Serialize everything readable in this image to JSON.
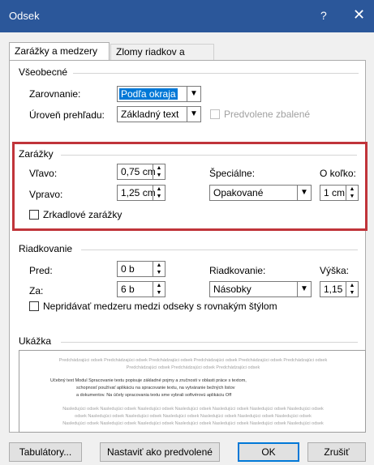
{
  "window": {
    "title": "Odsek",
    "help": "?",
    "close": "✕"
  },
  "tabs": {
    "indents_spacing": "Zarážky a medzery",
    "line_page_breaks": "Zlomy riadkov a strán"
  },
  "general": {
    "title": "Všeobecné",
    "alignment_label": "Zarovnanie:",
    "alignment_value": "Podľa okraja",
    "outline_label": "Úroveň prehľadu:",
    "outline_value": "Základný text",
    "collapsed_label": "Predvolene zbalené"
  },
  "indentation": {
    "title": "Zarážky",
    "left_label": "Vľavo:",
    "left_value": "0,75 cm",
    "right_label": "Vpravo:",
    "right_value": "1,25 cm",
    "special_label": "Špeciálne:",
    "special_value": "Opakované",
    "by_label": "O koľko:",
    "by_value": "1 cm",
    "mirror_label": "Zrkadlové zarážky"
  },
  "spacing": {
    "title": "Riadkovanie",
    "before_label": "Pred:",
    "before_value": "0 b",
    "after_label": "Za:",
    "after_value": "6 b",
    "line_label": "Riadkovanie:",
    "line_value": "Násobky",
    "at_label": "Výška:",
    "at_value": "1,15",
    "dont_add_label": "Nepridávať medzeru medzi odseky s rovnakým štýlom"
  },
  "preview": {
    "title": "Ukážka",
    "prev_line1": "Predchádzajúci odsek Predchádzajúci odsek Predchádzajúci odsek Predchádzajúci odsek Predchádzajúci odsek Predchádzajúci odsek",
    "prev_line2": "Predchádzajúci odsek Predchádzajúci odsek Predchádzajúci odsek",
    "sample_line1": "Učebný text Modul Spracovanie textu popisuje základné pojmy a zručnosti v oblasti práce s textom,",
    "sample_line2": "schopnosť používať aplikáciu na spracovanie textu, na vytváranie bežných listov",
    "sample_line3": "a dokumentov. Na účely spracovania textu sme vybrali softvérovú aplikáciu Off",
    "next_line1": "Nasledujúci odsek Nasledujúci odsek Nasledujúci odsek Nasledujúci odsek Nasledujúci odsek Nasledujúci odsek Nasledujúci odsek",
    "next_line2": "odsek Nasledujúci odsek Nasledujúci odsek Nasledujúci odsek Nasledujúci odsek Nasledujúci odsek Nasledujúci odsek",
    "next_line3": "Nasledujúci odsek Nasledujúci odsek Nasledujúci odsek Nasledujúci odsek Nasledujúci odsek Nasledujúci odsek Nasledujúci odsek"
  },
  "buttons": {
    "tabs": "Tabulátory...",
    "set_default": "Nastaviť ako predvolené",
    "ok": "OK",
    "cancel": "Zrušiť"
  },
  "colors": {
    "titlebar": "#2b579a",
    "highlight": "#c0343a",
    "selection": "#0078d7"
  }
}
